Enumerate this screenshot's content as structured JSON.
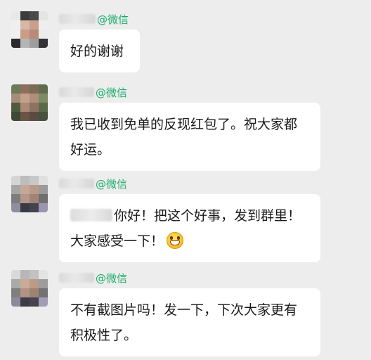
{
  "messages": [
    {
      "sender_suffix": "@微信",
      "lines": [
        "好的谢谢"
      ]
    },
    {
      "sender_suffix": "@微信",
      "lines": [
        "我已收到免单的反现红包了。祝大家都",
        "好运。"
      ]
    },
    {
      "sender_suffix": "@微信",
      "lines": [
        "你好！把这个好事，发到群里！",
        "大家感受一下！"
      ],
      "emoji": "grinning-face-emoji"
    },
    {
      "sender_suffix": "@微信",
      "lines": [
        "不有截图片吗！发一下，下次大家更有",
        "积极性了。"
      ]
    }
  ],
  "colors": {
    "background": "#ededed",
    "bubble": "#ffffff",
    "wechat_tag": "#1aad6a",
    "text": "#1a1a1a"
  }
}
